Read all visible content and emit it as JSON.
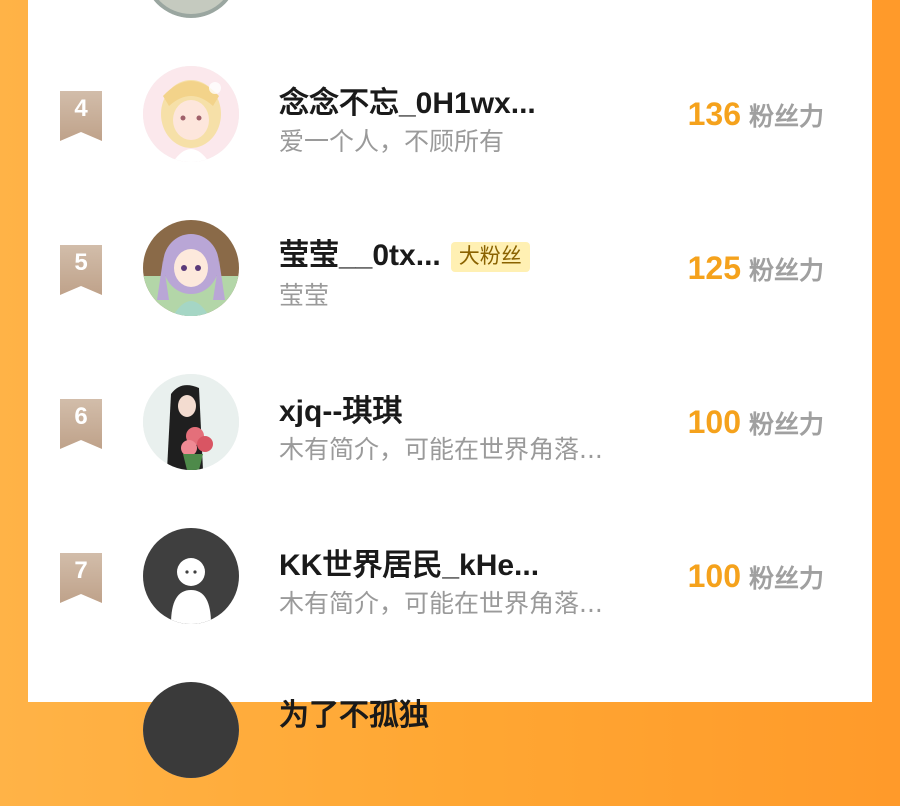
{
  "rows": [
    {
      "rank": "4",
      "name": "念念不忘_0H1wx...",
      "bio": "爱一个人，不顾所有",
      "score": "136",
      "unit": "粉丝力",
      "badge": "",
      "avatar_icon": "anime-girl-blonde-avatar"
    },
    {
      "rank": "5",
      "name": "莹莹__0tx...",
      "bio": "莹莹",
      "score": "125",
      "unit": "粉丝力",
      "badge": "大粉丝",
      "avatar_icon": "anime-girl-purple-hair-avatar"
    },
    {
      "rank": "6",
      "name": "xjq--琪琪",
      "bio": "木有简介，可能在世界角落...",
      "score": "100",
      "unit": "粉丝力",
      "badge": "",
      "avatar_icon": "girl-with-flowers-avatar"
    },
    {
      "rank": "7",
      "name": "KK世界居民_kHe...",
      "bio": "木有简介，可能在世界角落...",
      "score": "100",
      "unit": "粉丝力",
      "badge": "",
      "avatar_icon": "default-user-avatar"
    },
    {
      "rank": "",
      "name": "为了不孤独",
      "bio": "",
      "score": "",
      "unit": "",
      "badge": "",
      "avatar_icon": "dark-avatar"
    }
  ],
  "colors": {
    "accent": "#f5a21c",
    "rank_badge": "#c9b09a",
    "fan_badge_bg": "#fff0b3"
  }
}
